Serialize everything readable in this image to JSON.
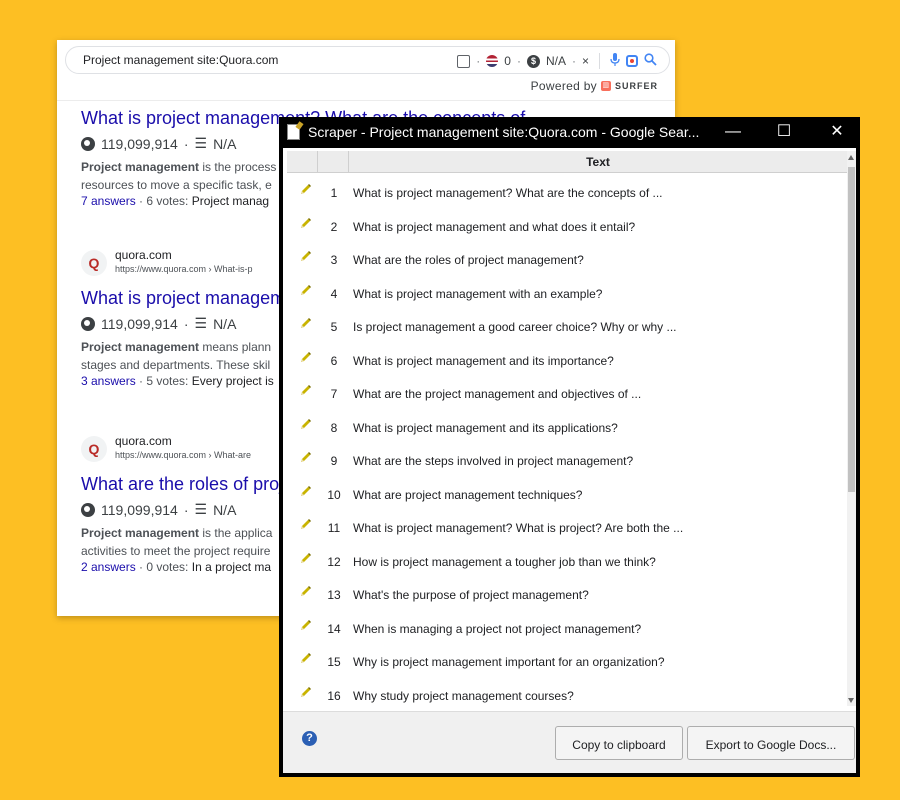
{
  "search": {
    "query": "Project management site:Quora.com",
    "tool_count": "0",
    "tool_value": "N/A",
    "close_label": "×",
    "powered_label": "Powered by",
    "surfer_label": "SURFER"
  },
  "results": [
    {
      "site_name": "",
      "site_url": "",
      "title": "What is project management? What are the concepts of ...",
      "views": "119,099,914",
      "meta_value": "N/A",
      "snippet_bold": "Project management",
      "snippet_rest": " is the process",
      "snippet_line2": "resources to move a specific task, e",
      "answers_link": "7 answers",
      "answers_rest": " · 6 votes: ",
      "answers_bold": "Project manag"
    },
    {
      "site_name": "quora.com",
      "site_url": "https://www.quora.com › What-is-p",
      "title": "What is project managem",
      "views": "119,099,914",
      "meta_value": "N/A",
      "snippet_bold": "Project management",
      "snippet_rest": " means plann",
      "snippet_line2": "stages and departments. These skil",
      "answers_link": "3 answers",
      "answers_rest": " · 5 votes: ",
      "answers_bold": "Every project is"
    },
    {
      "site_name": "quora.com",
      "site_url": "https://www.quora.com › What-are",
      "title": "What are the roles of proj",
      "views": "119,099,914",
      "meta_value": "N/A",
      "snippet_bold": "Project management",
      "snippet_rest": " is the applica",
      "snippet_line2": "activities to meet the project require",
      "answers_link": "2 answers",
      "answers_rest": " · 0 votes: ",
      "answers_bold": "In a project ma"
    }
  ],
  "scraper": {
    "title": "Scraper - Project management site:Quora.com - Google Sear...",
    "minimize": "—",
    "maximize": "☐",
    "close": "✕",
    "column_header": "Text",
    "rows": [
      {
        "num": "1",
        "text": "What is project management? What are the concepts of ..."
      },
      {
        "num": "2",
        "text": "What is project management and what does it entail?"
      },
      {
        "num": "3",
        "text": "What are the roles of project management?"
      },
      {
        "num": "4",
        "text": "What is project management with an example?"
      },
      {
        "num": "5",
        "text": "Is project management a good career choice? Why or why ..."
      },
      {
        "num": "6",
        "text": "What is project management and its importance?"
      },
      {
        "num": "7",
        "text": "What are the project management and objectives of ..."
      },
      {
        "num": "8",
        "text": "What is project management and its applications?"
      },
      {
        "num": "9",
        "text": "What are the steps involved in project management?"
      },
      {
        "num": "10",
        "text": "What are project management techniques?"
      },
      {
        "num": "11",
        "text": "What is project management? What is project? Are both the ..."
      },
      {
        "num": "12",
        "text": "How is project management a tougher job than we think?"
      },
      {
        "num": "13",
        "text": "What's the purpose of project management?"
      },
      {
        "num": "14",
        "text": "When is managing a project not project management?"
      },
      {
        "num": "15",
        "text": "Why is project management important for an organization?"
      },
      {
        "num": "16",
        "text": "Why study project management courses?"
      }
    ],
    "help_label": "?",
    "copy_button": "Copy to clipboard",
    "export_button": "Export to Google Docs..."
  }
}
